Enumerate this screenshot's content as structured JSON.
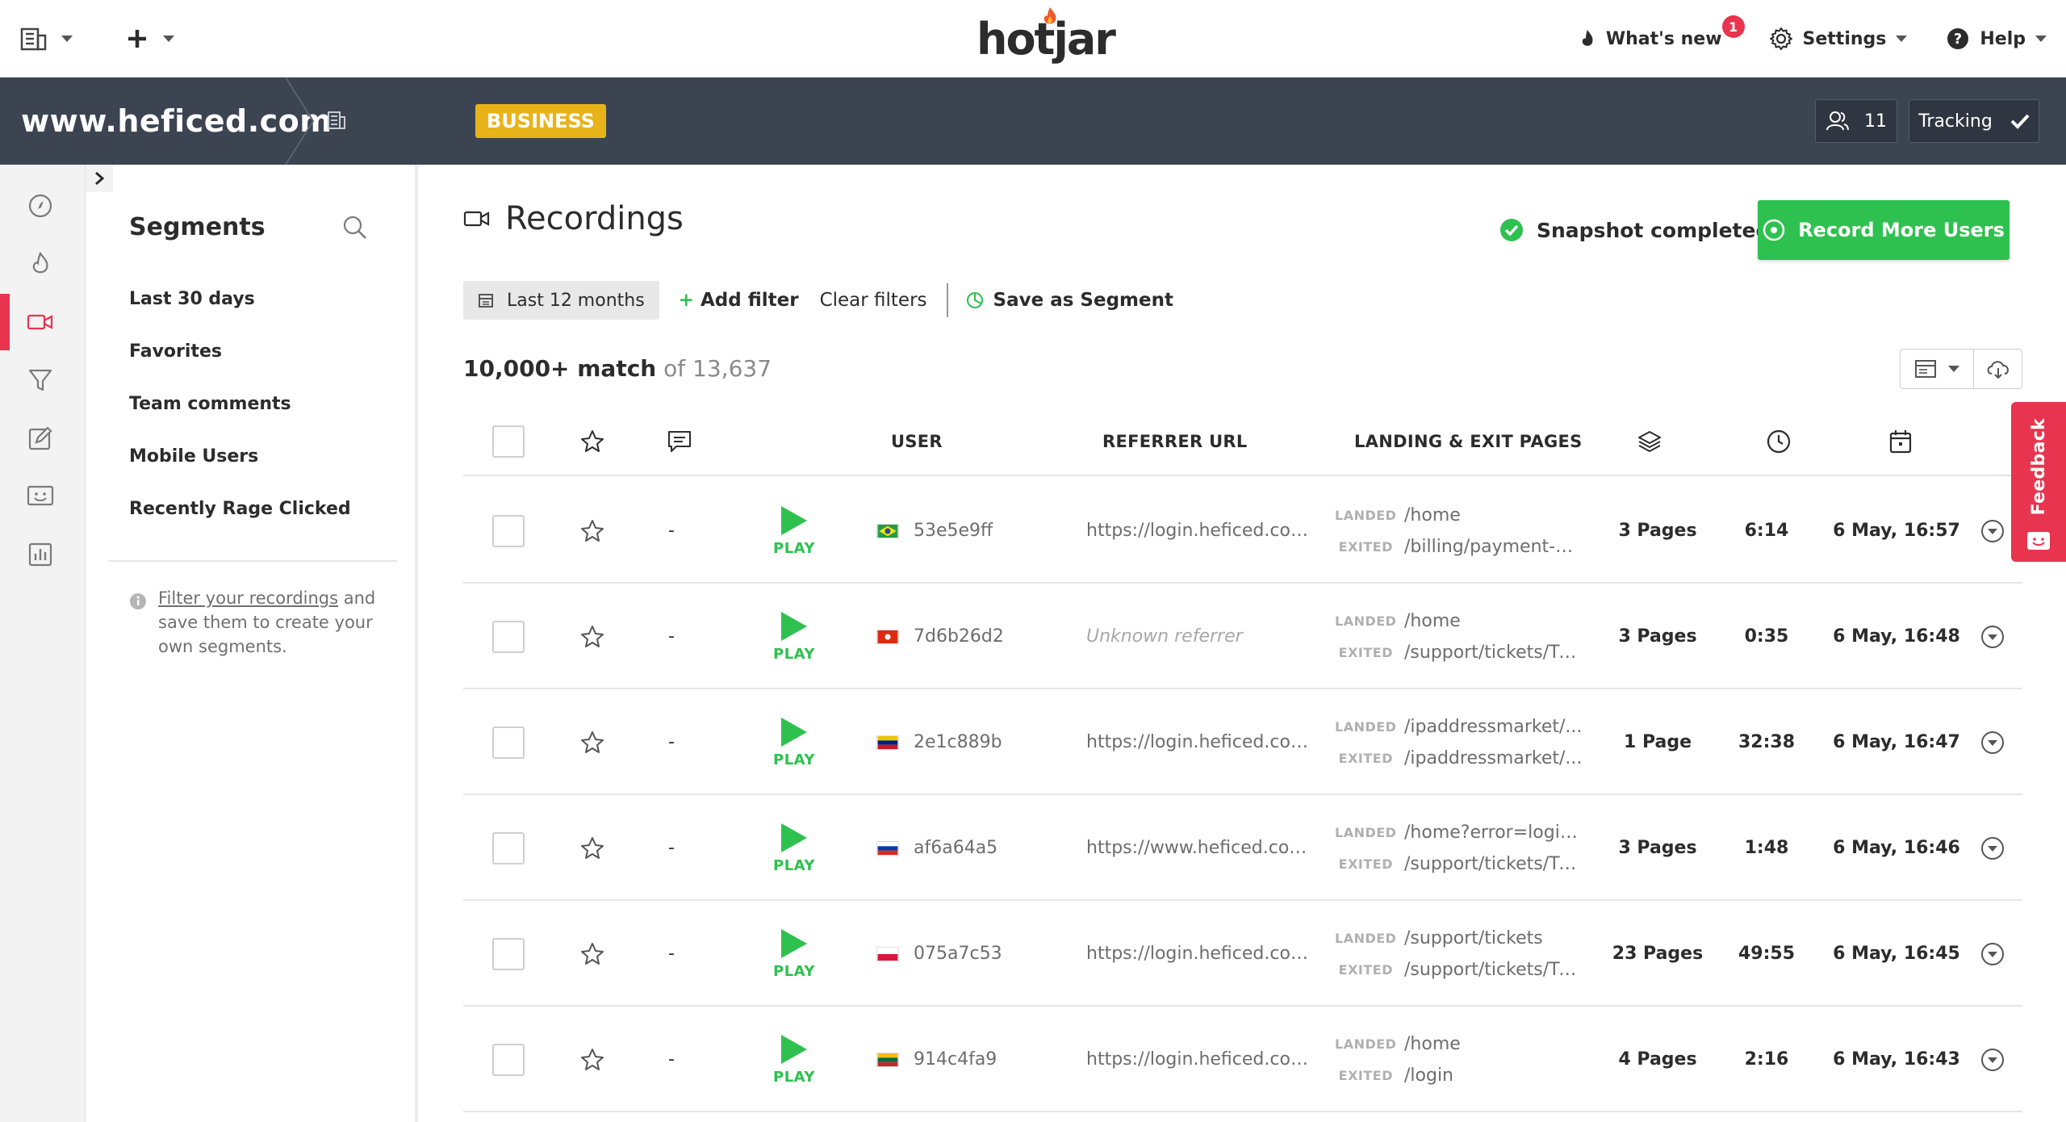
{
  "brand": {
    "logo_text": "hotjar",
    "accent": "#e8344e",
    "green": "#2ec14f",
    "header_bg": "#3c4452",
    "badge_color": "#e8b318"
  },
  "topbar": {
    "whats_new": "What's new",
    "whats_new_count": "1",
    "settings": "Settings",
    "help": "Help",
    "icons": [
      "organization-icon",
      "plus-icon",
      "flame-icon",
      "gear-icon",
      "question-icon"
    ]
  },
  "site": {
    "name": "www.heficed.com",
    "plan": "BUSINESS",
    "users_count": "11",
    "tracking_label": "Tracking"
  },
  "leftnav": {
    "items": [
      "dashboard-icon",
      "heatmaps-icon",
      "recordings-icon",
      "funnels-icon",
      "forms-icon",
      "feedback-icon",
      "reports-icon"
    ],
    "active_index": 2
  },
  "segments": {
    "title": "Segments",
    "items": [
      {
        "label": "Last 30 days"
      },
      {
        "label": "Favorites"
      },
      {
        "label": "Team comments"
      },
      {
        "label": "Mobile Users"
      },
      {
        "label": "Recently Rage Clicked"
      }
    ],
    "info_link": "Filter your recordings",
    "info_text": " and save them to create your own segments."
  },
  "main": {
    "title": "Recordings",
    "snapshot": "Snapshot completed",
    "record_button": "Record More Users",
    "filters": {
      "date": "Last 12 months",
      "add_filter": "Add filter",
      "clear_filters": "Clear filters",
      "save_segment": "Save as Segment"
    },
    "match_count": "10,000+ match",
    "match_total": "of 13,637"
  },
  "table": {
    "headers": {
      "user": "USER",
      "referrer": "REFERRER URL",
      "pages": "LANDING & EXIT PAGES"
    },
    "landed_label": "LANDED",
    "exited_label": "EXITED",
    "play_label": "PLAY",
    "rows": [
      {
        "comment": "-",
        "flag": "br",
        "user": "53e5e9ff",
        "referrer": "https://login.heficed.com...",
        "unknown": false,
        "landed": "/home",
        "exited": "/billing/payment-m...",
        "pages": "3 Pages",
        "duration": "6:14",
        "date": "6 May, 16:57"
      },
      {
        "comment": "-",
        "flag": "hk",
        "user": "7d6b26d2",
        "referrer": "Unknown referrer",
        "unknown": true,
        "landed": "/home",
        "exited": "/support/tickets/TC...",
        "pages": "3 Pages",
        "duration": "0:35",
        "date": "6 May, 16:48"
      },
      {
        "comment": "-",
        "flag": "ve",
        "user": "2e1c889b",
        "referrer": "https://login.heficed.com...",
        "unknown": false,
        "landed": "/ipaddressmarket/...",
        "exited": "/ipaddressmarket/...",
        "pages": "1 Page",
        "duration": "32:38",
        "date": "6 May, 16:47"
      },
      {
        "comment": "-",
        "flag": "ru",
        "user": "af6a64a5",
        "referrer": "https://www.heficed.com...",
        "unknown": false,
        "landed": "/home?error=login_...",
        "exited": "/support/tickets/TC...",
        "pages": "3 Pages",
        "duration": "1:48",
        "date": "6 May, 16:46"
      },
      {
        "comment": "-",
        "flag": "pl",
        "user": "075a7c53",
        "referrer": "https://login.heficed.com...",
        "unknown": false,
        "landed": "/support/tickets",
        "exited": "/support/tickets/TC...",
        "pages": "23 Pages",
        "duration": "49:55",
        "date": "6 May, 16:45"
      },
      {
        "comment": "-",
        "flag": "lt",
        "user": "914c4fa9",
        "referrer": "https://login.heficed.com...",
        "unknown": false,
        "landed": "/home",
        "exited": "/login",
        "pages": "4 Pages",
        "duration": "2:16",
        "date": "6 May, 16:43"
      }
    ]
  },
  "feedback_tab": {
    "label": "Feedback"
  }
}
